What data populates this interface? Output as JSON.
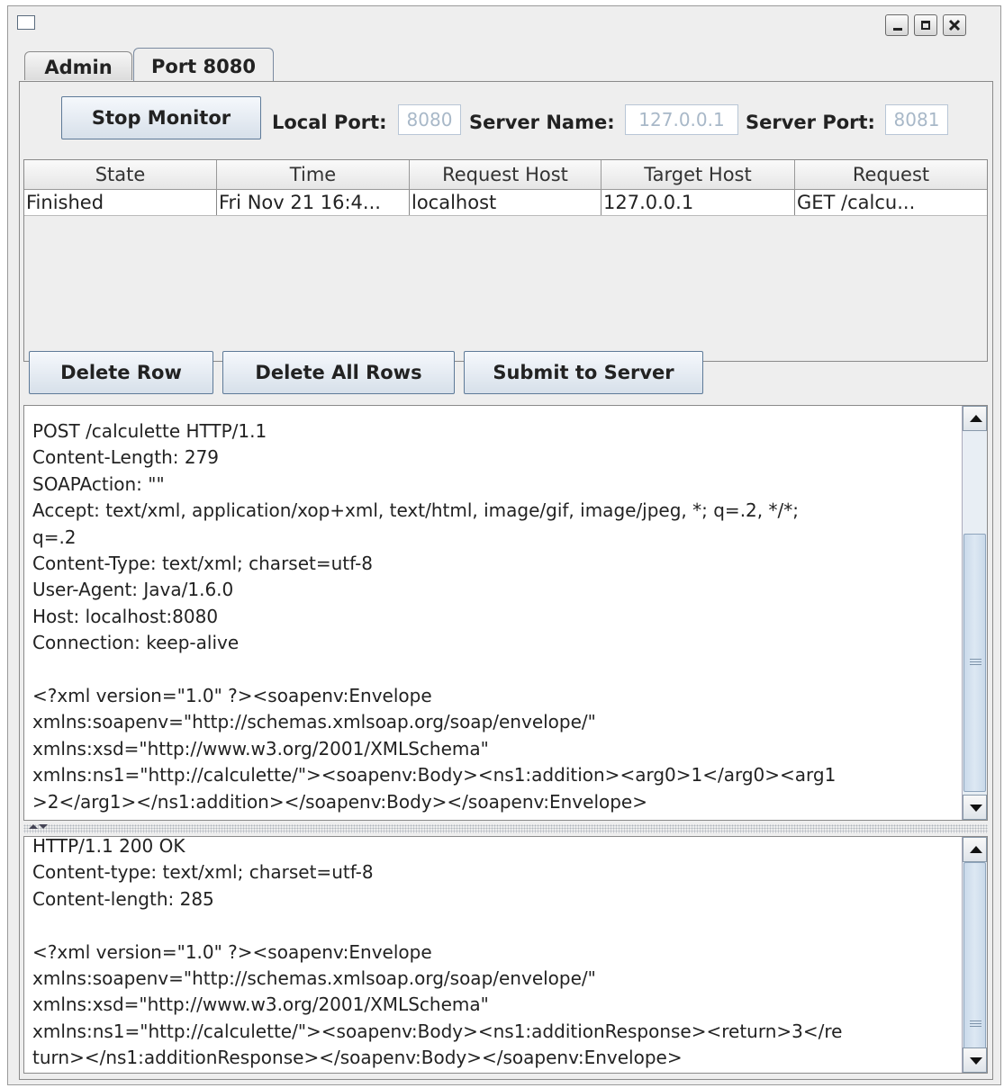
{
  "window": {
    "icon": "window-icon",
    "controls": [
      "minimize-icon",
      "maximize-icon",
      "close-icon"
    ]
  },
  "tabs": [
    {
      "label": "Admin",
      "selected": false
    },
    {
      "label": "Port 8080",
      "selected": true
    }
  ],
  "toolbar": {
    "stop_label": "Stop Monitor",
    "local_port_label": "Local Port:",
    "local_port_value": "8080",
    "server_name_label": "Server Name:",
    "server_name_value": "127.0.0.1",
    "server_port_label": "Server Port:",
    "server_port_value": "8081"
  },
  "table": {
    "columns": [
      "State",
      "Time",
      "Request Host",
      "Target Host",
      "Request"
    ],
    "rows": [
      [
        "Finished",
        "Fri Nov 21 16:4...",
        "localhost",
        "127.0.0.1",
        "GET /calcu..."
      ]
    ]
  },
  "actions": {
    "delete_row": "Delete Row",
    "delete_all": "Delete All Rows",
    "submit": "Submit to Server"
  },
  "request_text": "POST /calculette HTTP/1.1\nContent-Length: 279\nSOAPAction: \"\"\nAccept: text/xml, application/xop+xml, text/html, image/gif, image/jpeg, *; q=.2, */*;\nq=.2\nContent-Type: text/xml; charset=utf-8\nUser-Agent: Java/1.6.0\nHost: localhost:8080\nConnection: keep-alive\n\n<?xml version=\"1.0\" ?><soapenv:Envelope\nxmlns:soapenv=\"http://schemas.xmlsoap.org/soap/envelope/\"\nxmlns:xsd=\"http://www.w3.org/2001/XMLSchema\"\nxmlns:ns1=\"http://calculette/\"><soapenv:Body><ns1:addition><arg0>1</arg0><arg1\n>2</arg1></ns1:addition></soapenv:Body></soapenv:Envelope>",
  "response_text": "HTTP/1.1 200 OK\nContent-type: text/xml; charset=utf-8\nContent-length: 285\n\n<?xml version=\"1.0\" ?><soapenv:Envelope\nxmlns:soapenv=\"http://schemas.xmlsoap.org/soap/envelope/\"\nxmlns:xsd=\"http://www.w3.org/2001/XMLSchema\"\nxmlns:ns1=\"http://calculette/\"><soapenv:Body><ns1:additionResponse><return>3</re\nturn></ns1:additionResponse></soapenv:Body></soapenv:Envelope>",
  "colors": {
    "button_border": "#5e7a98",
    "field_text": "#a8b8c8",
    "scroll_thumb": "#c9d9ea"
  }
}
